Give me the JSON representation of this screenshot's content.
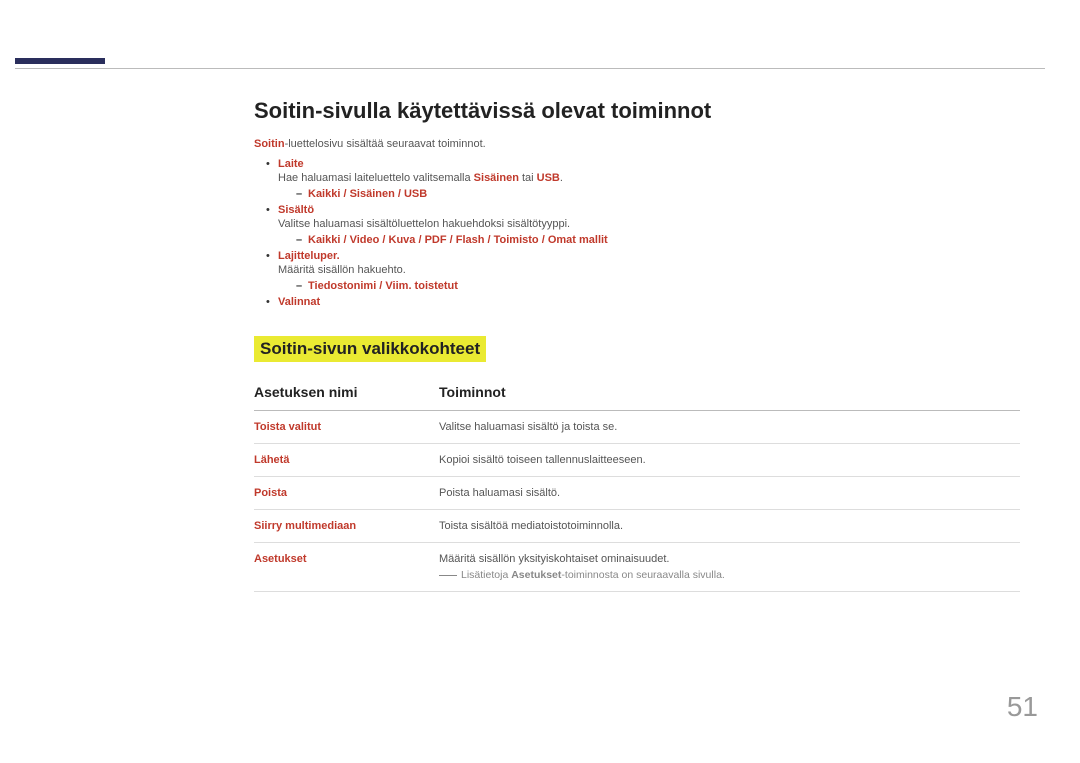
{
  "page_title": "Soitin-sivulla käytettävissä olevat toiminnot",
  "intro_strong": "Soitin",
  "intro_rest": "-luettelosivu sisältää seuraavat toiminnot.",
  "bullets": {
    "b1_label": "Laite",
    "b1_desc_1": "Hae haluamasi laiteluettelo valitsemalla ",
    "b1_desc_s1": "Sisäinen",
    "b1_desc_mid": " tai ",
    "b1_desc_s2": "USB",
    "b1_sub": "Kaikki / Sisäinen / USB",
    "b2_label": "Sisältö",
    "b2_desc": "Valitse haluamasi sisältöluettelon hakuehdoksi sisältötyyppi.",
    "b2_sub": "Kaikki / Video / Kuva / PDF / Flash / Toimisto / Omat mallit",
    "b3_label": "Lajitteluper.",
    "b3_desc": "Määritä sisällön hakuehto.",
    "b3_sub": "Tiedostonimi / Viim. toistetut",
    "b4_label": "Valinnat"
  },
  "section_title": "Soitin-sivun valikkokohteet",
  "th1": "Asetuksen nimi",
  "th2": "Toiminnot",
  "rows": [
    {
      "name": "Toista valitut",
      "func": "Valitse haluamasi sisältö ja toista se."
    },
    {
      "name": "Lähetä",
      "func": "Kopioi sisältö toiseen tallennuslaitteeseen."
    },
    {
      "name": "Poista",
      "func": "Poista haluamasi sisältö."
    },
    {
      "name": "Siirry multimediaan",
      "func": "Toista sisältöä mediatoistotoiminnolla."
    },
    {
      "name": "Asetukset",
      "func": "Määritä sisällön yksityiskohtaiset ominaisuudet."
    }
  ],
  "note_pre": "Lisätietoja ",
  "note_strong": "Asetukset",
  "note_post": "-toiminnosta on seuraavalla sivulla.",
  "page_number": "51"
}
